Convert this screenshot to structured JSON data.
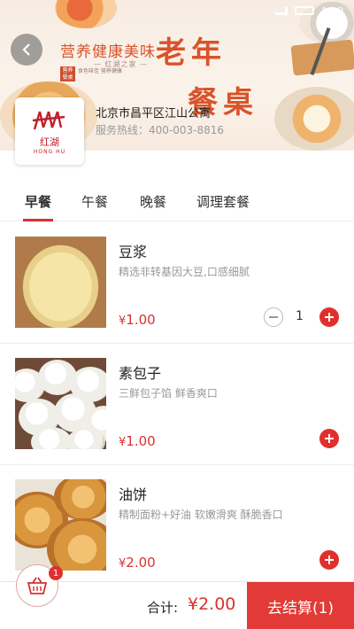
{
  "status_bar": {
    "time": "1:00"
  },
  "banner": {
    "slogan": "营养健康美味",
    "slogan_sub": "— 红湖之家 —",
    "seal_text": "营养 餐桌",
    "seal_caption": "食色味佳 营养健康",
    "title_line1": "老年",
    "title_line2": "餐桌"
  },
  "shop": {
    "logo_cn": "红湖",
    "logo_en": "HONG HU",
    "address": "北京市昌平区江山公寓",
    "phone": "服务热线：400-003-8816"
  },
  "tabs": [
    {
      "label": "早餐",
      "active": true
    },
    {
      "label": "午餐",
      "active": false
    },
    {
      "label": "晚餐",
      "active": false
    },
    {
      "label": "调理套餐",
      "active": false
    }
  ],
  "items": [
    {
      "name": "豆浆",
      "desc": "精选非转基因大豆,口感细腻",
      "currency": "¥",
      "price": "1.00",
      "qty": "1"
    },
    {
      "name": "素包子",
      "desc": "三鲜包子馅 鲜香爽口",
      "currency": "¥",
      "price": "1.00"
    },
    {
      "name": "油饼",
      "desc": "精制面粉+好油 软嫩滑爽 酥脆香口",
      "currency": "¥",
      "price": "2.00"
    }
  ],
  "cart": {
    "badge": "1",
    "total_label": "合计:",
    "total_value": "¥2.00",
    "checkout_label": "去结算(1)"
  },
  "colors": {
    "accent": "#e0302e",
    "banner_title": "#d9532b"
  }
}
